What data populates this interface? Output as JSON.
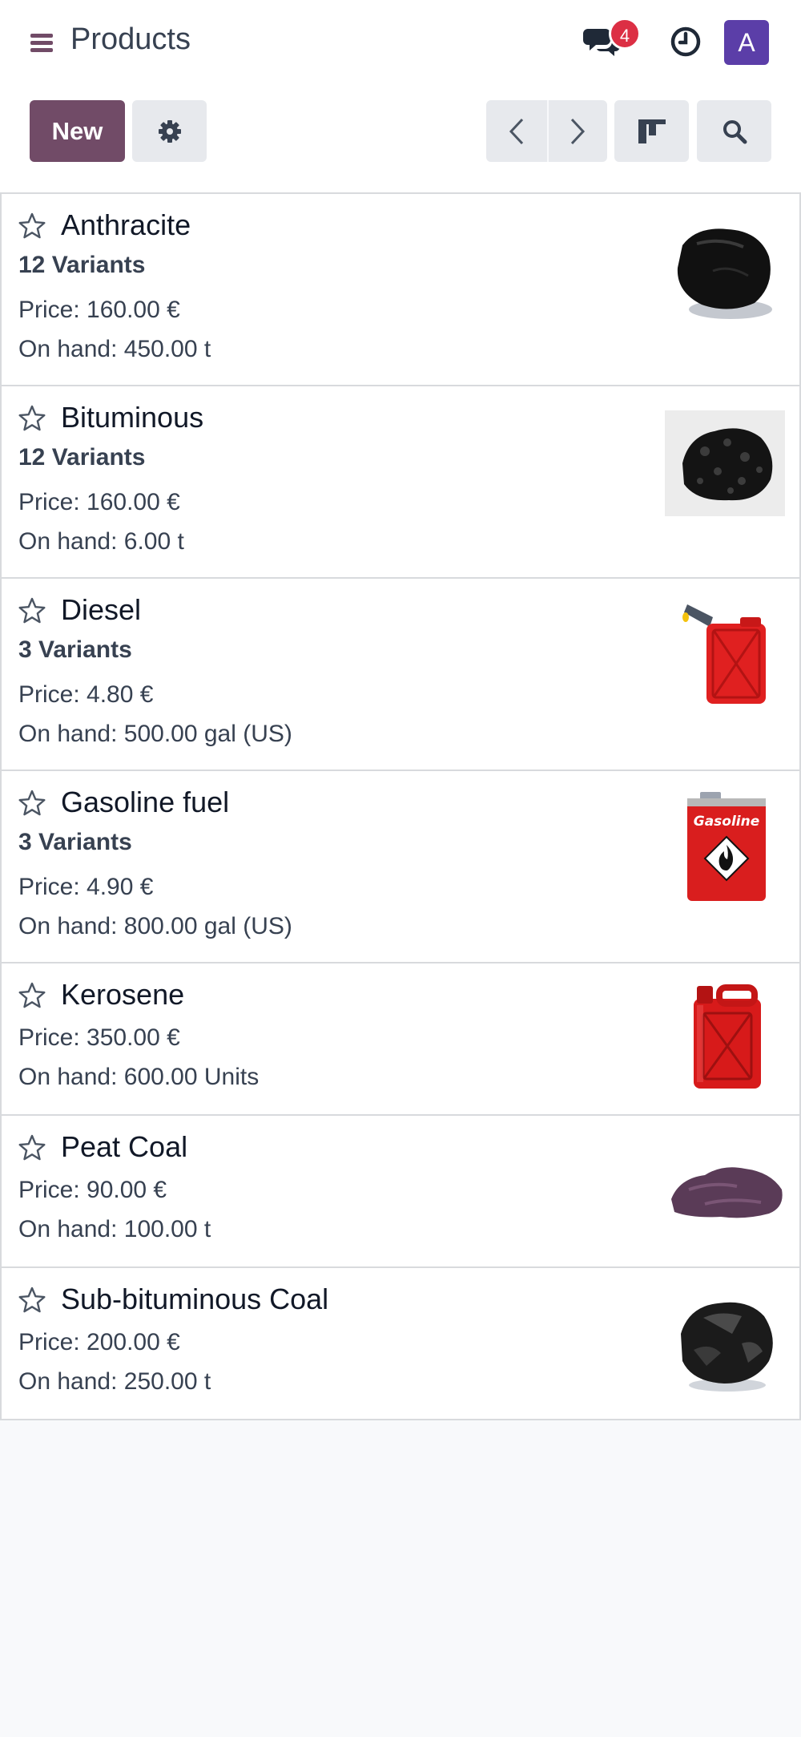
{
  "header": {
    "title": "Products",
    "messages_badge": "4",
    "avatar_letter": "A"
  },
  "toolbar": {
    "new_label": "New"
  },
  "products": [
    {
      "name": "Anthracite",
      "variants": "12 Variants",
      "price": "Price: 160.00 €",
      "on_hand": "On hand: 450.00 t",
      "image": "black-coal-chunk"
    },
    {
      "name": "Bituminous",
      "variants": "12 Variants",
      "price": "Price: 160.00 €",
      "on_hand": "On hand: 6.00 t",
      "image": "coal-granules"
    },
    {
      "name": "Diesel",
      "variants": "3 Variants",
      "price": "Price: 4.80 €",
      "on_hand": "On hand: 500.00 gal (US)",
      "image": "red-jerrycan-spout"
    },
    {
      "name": "Gasoline fuel",
      "variants": "3 Variants",
      "price": "Price: 4.90 €",
      "on_hand": "On hand: 800.00 gal (US)",
      "image": "gasoline-can",
      "image_label": "Gasoline"
    },
    {
      "name": "Kerosene",
      "price": "Price: 350.00 €",
      "on_hand": "On hand: 600.00 Units",
      "image": "red-jerrycan"
    },
    {
      "name": "Peat Coal",
      "price": "Price: 90.00 €",
      "on_hand": "On hand: 100.00 t",
      "image": "purple-peat-rock"
    },
    {
      "name": "Sub-bituminous Coal",
      "price": "Price: 200.00 €",
      "on_hand": "On hand: 250.00 t",
      "image": "black-coal-rock"
    }
  ],
  "colors": {
    "brand": "#714b67",
    "badge": "#dc2f44",
    "avatar": "#5b3ea8",
    "button_secondary": "#e7e9ed"
  }
}
